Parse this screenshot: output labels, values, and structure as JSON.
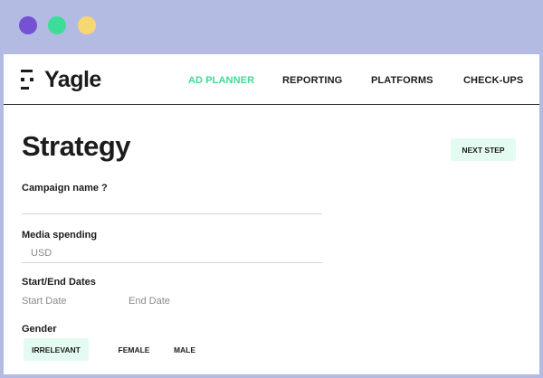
{
  "window_controls": {
    "colors": [
      "#7452d3",
      "#3ddc97",
      "#f7d774"
    ]
  },
  "app": {
    "logo_text": "Yagle",
    "logo_icon": "robot-face-icon"
  },
  "nav": {
    "items": [
      {
        "label": "AD PLANNER",
        "active": true
      },
      {
        "label": "REPORTING",
        "active": false
      },
      {
        "label": "PLATFORMS",
        "active": false
      },
      {
        "label": "CHECK-UPS",
        "active": false
      }
    ]
  },
  "page": {
    "title": "Strategy",
    "next_step_label": "NEXT STEP"
  },
  "form": {
    "campaign_name": {
      "label": "Campaign name ?",
      "value": ""
    },
    "media_spending": {
      "label": "Media spending",
      "placeholder": "USD"
    },
    "dates": {
      "label": "Start/End Dates",
      "start_placeholder": "Start Date",
      "end_placeholder": "End Date"
    },
    "gender": {
      "label": "Gender",
      "options": [
        "IRRELEVANT",
        "FEMALE",
        "MALE"
      ],
      "selected": "IRRELEVANT"
    }
  },
  "colors": {
    "accent": "#3ddc97",
    "accent_bg": "#e3fbf1",
    "text": "#1c1c1c",
    "background": "#b3bbe3"
  }
}
